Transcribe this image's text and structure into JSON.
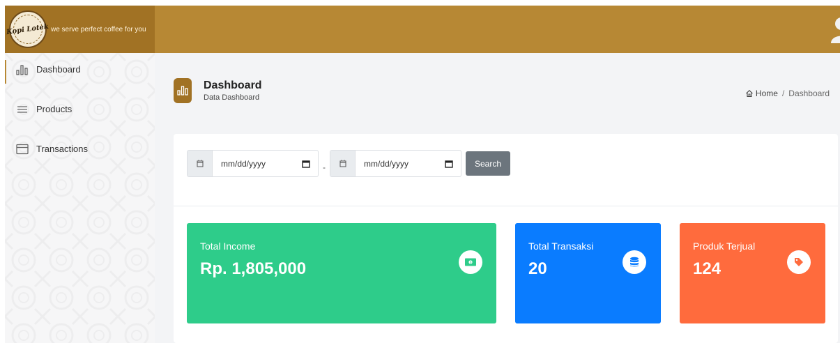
{
  "brand": {
    "logo_text": "Kopi Lotek",
    "tagline": "we serve perfect coffee for you"
  },
  "sidebar": {
    "items": [
      {
        "label": "Dashboard",
        "icon": "bar-chart-icon",
        "active": true
      },
      {
        "label": "Products",
        "icon": "menu-lines-icon",
        "active": false
      },
      {
        "label": "Transactions",
        "icon": "window-icon",
        "active": false
      }
    ]
  },
  "page": {
    "title": "Dashboard",
    "subtitle": "Data Dashboard"
  },
  "breadcrumb": {
    "home": "Home",
    "separator": "/",
    "current": "Dashboard"
  },
  "filter": {
    "start_placeholder": "mm/dd/yyyy",
    "end_placeholder": "mm/dd/yyyy",
    "separator": "-",
    "search_label": "Search"
  },
  "stats": [
    {
      "label": "Total Income",
      "value": "Rp. 1,805,000",
      "icon": "money-icon",
      "color": "#2ecc8a"
    },
    {
      "label": "Total Transaksi",
      "value": "20",
      "icon": "database-icon",
      "color": "#0a7cff"
    },
    {
      "label": "Produk Terjual",
      "value": "124",
      "icon": "tag-icon",
      "color": "#ff6b3d"
    }
  ],
  "colors": {
    "header": "#b78834",
    "brand_bg": "#a17224",
    "search_button": "#6c757d"
  }
}
